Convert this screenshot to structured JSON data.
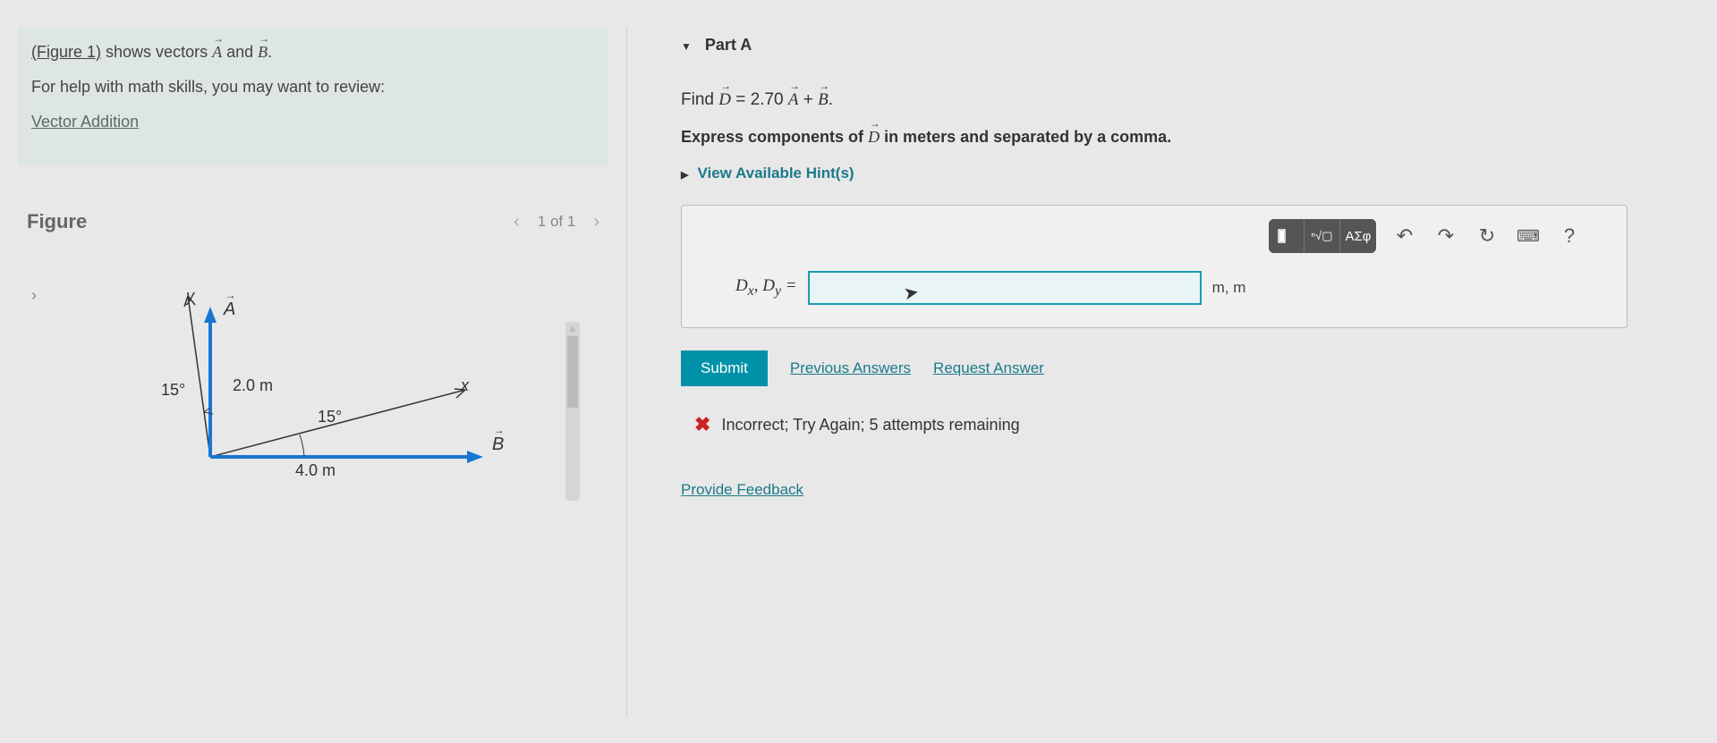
{
  "intro": {
    "figure_link": "(Figure 1)",
    "shows_text": " shows vectors ",
    "vecA": "A",
    "and_text": " and ",
    "vecB": "B",
    "period": ".",
    "help_text": "For help with math skills, you may want to review:",
    "vector_addition": "Vector Addition"
  },
  "figure": {
    "title": "Figure",
    "nav": "1 of 1",
    "y": "y",
    "x": "x",
    "A": "A",
    "B": "B",
    "angle1": "15°",
    "angle2": "15°",
    "lenA": "2.0 m",
    "lenB": "4.0 m"
  },
  "partA": {
    "title": "Part A",
    "find_prefix": "Find ",
    "eq_D": "D",
    "eq_mid": " = 2.70 ",
    "eq_A": "A",
    "eq_plus": " + ",
    "eq_B": "B",
    "eq_end": ".",
    "instruction_pre": "Express components of ",
    "instruction_D": "D",
    "instruction_post": " in meters and separated by a comma.",
    "hints": "View Available Hint(s)",
    "toolbar": {
      "greek": "ΑΣφ",
      "help": "?"
    },
    "var_label": "Dₓ, D_y =",
    "units": "m, m",
    "submit": "Submit",
    "prev_answers": "Previous Answers",
    "request_answer": "Request Answer",
    "feedback": "Incorrect; Try Again; 5 attempts remaining",
    "provide_feedback": "Provide Feedback"
  }
}
